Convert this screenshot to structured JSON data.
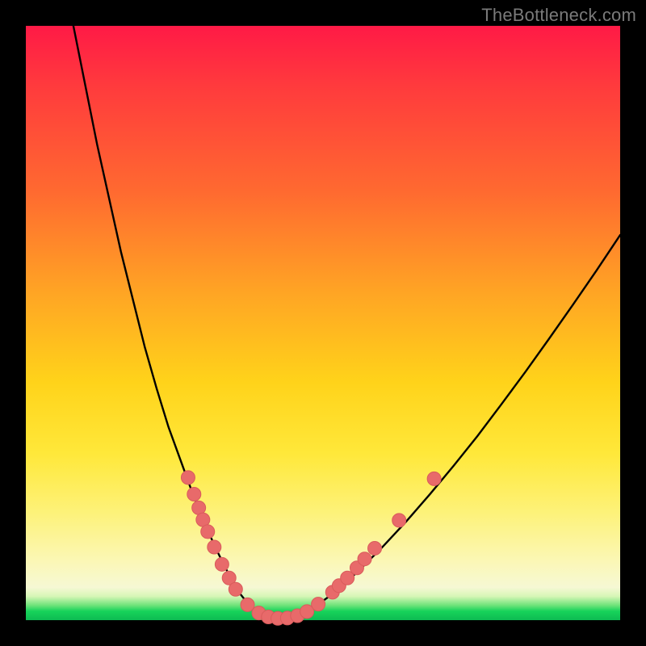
{
  "watermark": "TheBottleneck.com",
  "colors": {
    "background": "#000000",
    "curve_stroke": "#000000",
    "marker_fill": "#e86a6a",
    "marker_stroke": "#d95b5b"
  },
  "chart_data": {
    "type": "line",
    "title": "",
    "xlabel": "",
    "ylabel": "",
    "xlim": [
      0,
      100
    ],
    "ylim": [
      0,
      100
    ],
    "grid": false,
    "legend": false,
    "series": [
      {
        "name": "curve-left",
        "x": [
          8,
          10,
          12,
          14,
          16,
          18,
          20,
          22,
          24,
          26,
          28,
          30,
          32,
          34,
          36,
          38
        ],
        "values": [
          100,
          90,
          80,
          71,
          62,
          54,
          46,
          39,
          32.5,
          27,
          21.5,
          16.5,
          12,
          8,
          4.5,
          2
        ]
      },
      {
        "name": "curve-floor",
        "x": [
          38,
          40,
          42,
          44,
          46,
          48
        ],
        "values": [
          2,
          0.8,
          0.3,
          0.3,
          0.8,
          1.8
        ]
      },
      {
        "name": "curve-right",
        "x": [
          48,
          52,
          56,
          60,
          64,
          68,
          72,
          76,
          80,
          84,
          88,
          92,
          96,
          100
        ],
        "values": [
          1.8,
          4.7,
          8.3,
          12.3,
          16.6,
          21.2,
          26,
          31,
          36.3,
          41.7,
          47.3,
          53,
          58.8,
          64.8
        ]
      }
    ],
    "markers": [
      {
        "x": 27.3,
        "y": 24.0
      },
      {
        "x": 28.3,
        "y": 21.2
      },
      {
        "x": 29.1,
        "y": 18.9
      },
      {
        "x": 29.8,
        "y": 16.9
      },
      {
        "x": 30.6,
        "y": 14.9
      },
      {
        "x": 31.7,
        "y": 12.3
      },
      {
        "x": 33.0,
        "y": 9.4
      },
      {
        "x": 34.2,
        "y": 7.1
      },
      {
        "x": 35.3,
        "y": 5.2
      },
      {
        "x": 37.3,
        "y": 2.6
      },
      {
        "x": 39.2,
        "y": 1.2
      },
      {
        "x": 40.8,
        "y": 0.55
      },
      {
        "x": 42.4,
        "y": 0.3
      },
      {
        "x": 44.0,
        "y": 0.35
      },
      {
        "x": 45.7,
        "y": 0.75
      },
      {
        "x": 47.3,
        "y": 1.45
      },
      {
        "x": 49.2,
        "y": 2.7
      },
      {
        "x": 51.6,
        "y": 4.7
      },
      {
        "x": 52.7,
        "y": 5.8
      },
      {
        "x": 54.1,
        "y": 7.1
      },
      {
        "x": 55.7,
        "y": 8.8
      },
      {
        "x": 57.0,
        "y": 10.3
      },
      {
        "x": 58.7,
        "y": 12.1
      },
      {
        "x": 62.8,
        "y": 16.8
      },
      {
        "x": 68.7,
        "y": 23.8
      }
    ]
  }
}
